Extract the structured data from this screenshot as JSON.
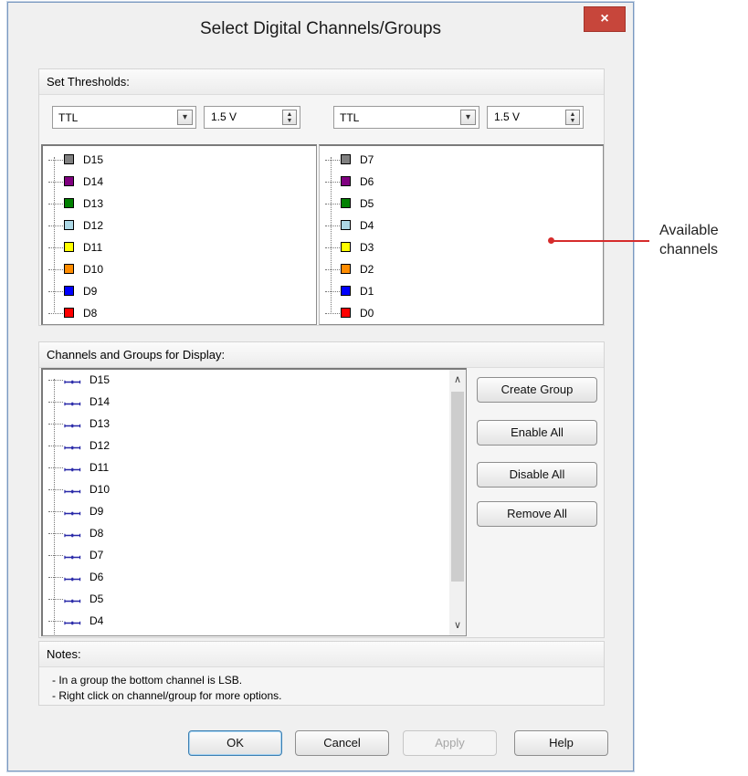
{
  "window": {
    "title": "Select Digital Channels/Groups",
    "close_glyph": "×"
  },
  "thresholds": {
    "header": "Set Thresholds:",
    "left": {
      "logic_family": "TTL",
      "voltage": "1.5 V"
    },
    "right": {
      "logic_family": "TTL",
      "voltage": "1.5 V"
    }
  },
  "available_channels": {
    "left": [
      {
        "label": "D15",
        "color": "#808080"
      },
      {
        "label": "D14",
        "color": "#800080"
      },
      {
        "label": "D13",
        "color": "#008000"
      },
      {
        "label": "D12",
        "color": "#add8e6"
      },
      {
        "label": "D11",
        "color": "#ffff00"
      },
      {
        "label": "D10",
        "color": "#ff8c00"
      },
      {
        "label": "D9",
        "color": "#0000ff"
      },
      {
        "label": "D8",
        "color": "#ff0000"
      }
    ],
    "right": [
      {
        "label": "D7",
        "color": "#808080"
      },
      {
        "label": "D6",
        "color": "#800080"
      },
      {
        "label": "D5",
        "color": "#008000"
      },
      {
        "label": "D4",
        "color": "#add8e6"
      },
      {
        "label": "D3",
        "color": "#ffff00"
      },
      {
        "label": "D2",
        "color": "#ff8c00"
      },
      {
        "label": "D1",
        "color": "#0000ff"
      },
      {
        "label": "D0",
        "color": "#ff0000"
      }
    ]
  },
  "display": {
    "header": "Channels and Groups for Display:",
    "pulse_glyph": "ꟷꟷ",
    "items": [
      "D15",
      "D14",
      "D13",
      "D12",
      "D11",
      "D10",
      "D9",
      "D8",
      "D7",
      "D6",
      "D5",
      "D4"
    ],
    "buttons": {
      "create_group": "Create Group",
      "enable_all": "Enable All",
      "disable_all": "Disable All",
      "remove_all": "Remove All"
    }
  },
  "notes": {
    "header": "Notes:",
    "line1": "- In a group the bottom channel is LSB.",
    "line2": "- Right click on channel/group for more options."
  },
  "footer_buttons": {
    "ok": "OK",
    "cancel": "Cancel",
    "apply": "Apply",
    "help": "Help"
  },
  "annotation": {
    "line1": "Available",
    "line2": "channels"
  }
}
